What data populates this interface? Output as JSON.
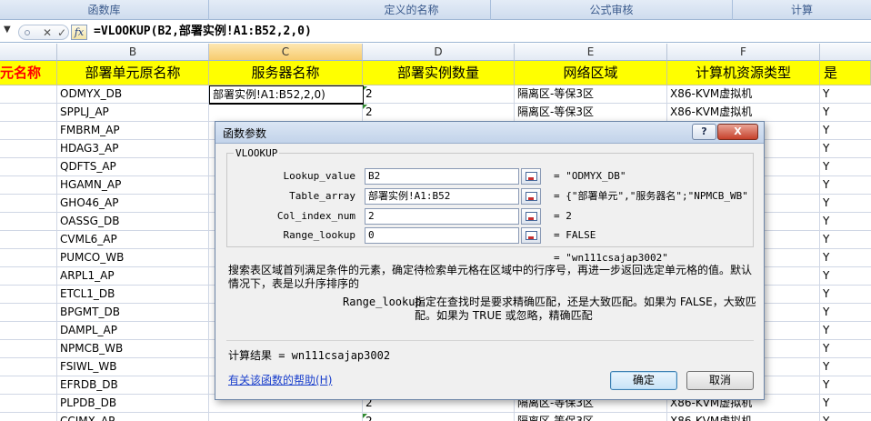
{
  "ribbon": {
    "groups": [
      "函数库",
      "定义的名称",
      "公式审核",
      "计算"
    ]
  },
  "formula_bar": {
    "formula": "=VLOOKUP(B2,部署实例!A1:B52,2,0)",
    "fx_label": "fx"
  },
  "columns": [
    "B",
    "C",
    "D",
    "E",
    "F"
  ],
  "header_row": [
    "元名称",
    "部署单元原名称",
    "服务器名称",
    "部署实例数量",
    "网络区域",
    "计算机资源类型",
    "是"
  ],
  "editing_cell_text": "部署实例!A1:B52,2,0)",
  "rows": [
    {
      "b": "ODMYX_DB",
      "d": "2",
      "e": "隔离区-等保3区",
      "f": "X86-KVM虚拟机",
      "g": "Y"
    },
    {
      "b": "SPPLJ_AP",
      "d": "2",
      "e": "隔离区-等保3区",
      "f": "X86-KVM虚拟机",
      "g": "Y"
    },
    {
      "b": "FMBRM_AP",
      "d": "",
      "e": "",
      "f": "",
      "g": "Y"
    },
    {
      "b": "HDAG3_AP",
      "d": "",
      "e": "",
      "f": "",
      "g": "Y"
    },
    {
      "b": "QDFTS_AP",
      "d": "",
      "e": "",
      "f": "",
      "g": "Y"
    },
    {
      "b": "HGAMN_AP",
      "d": "",
      "e": "",
      "f": "",
      "g": "Y"
    },
    {
      "b": "GHO46_AP",
      "d": "",
      "e": "",
      "f": "",
      "g": "Y"
    },
    {
      "b": "OASSG_DB",
      "d": "",
      "e": "",
      "f": "",
      "g": "Y"
    },
    {
      "b": "CVML6_AP",
      "d": "",
      "e": "",
      "f": "",
      "g": "Y"
    },
    {
      "b": "PUMCO_WB",
      "d": "",
      "e": "",
      "f": "",
      "g": "Y"
    },
    {
      "b": "ARPL1_AP",
      "d": "",
      "e": "",
      "f": "",
      "g": "Y"
    },
    {
      "b": "ETCL1_DB",
      "d": "",
      "e": "",
      "f": "",
      "g": "Y"
    },
    {
      "b": "BPGMT_DB",
      "d": "",
      "e": "",
      "f": "",
      "g": "Y"
    },
    {
      "b": "DAMPL_AP",
      "d": "",
      "e": "",
      "f": "",
      "g": "Y"
    },
    {
      "b": "NPMCB_WB",
      "d": "",
      "e": "",
      "f": "",
      "g": "Y"
    },
    {
      "b": "FSIWL_WB",
      "d": "",
      "e": "",
      "f": "",
      "g": "Y"
    },
    {
      "b": "EFRDB_DB",
      "d": "",
      "e": "",
      "f": "",
      "g": "Y"
    },
    {
      "b": "PLPDB_DB",
      "d": "2",
      "e": "隔离区-等保3区",
      "f": "X86-KVM虚拟机",
      "g": "Y"
    },
    {
      "b": "CCIMX_AP",
      "d": "2",
      "e": "隔离区-等保3区",
      "f": "X86-KVM虚拟机",
      "g": "Y"
    }
  ],
  "dialog": {
    "title": "函数参数",
    "help_btn": "?",
    "close_btn": "X",
    "function_name": "VLOOKUP",
    "args": [
      {
        "label": "Lookup_value",
        "value": "B2",
        "result": "= \"ODMYX_DB\""
      },
      {
        "label": "Table_array",
        "value": "部署实例!A1:B52",
        "result": "= {\"部署单元\",\"服务器名\";\"NPMCB_WB\""
      },
      {
        "label": "Col_index_num",
        "value": "2",
        "result": "= 2"
      },
      {
        "label": "Range_lookup",
        "value": "0",
        "result": "= FALSE"
      }
    ],
    "overall_result": "= \"wn111csajap3002\"",
    "description": "搜索表区域首列满足条件的元素，确定待检索单元格在区域中的行序号，再进一步返回选定单元格的值。默认情况下，表是以升序排序的",
    "param_name": "Range_lookup",
    "param_desc_1": "指定在查找时是要求精确匹配，还是大致匹配。如果为 FALSE，大致匹",
    "param_desc_2": "配。如果为 TRUE 或忽略，精确匹配",
    "calc_result": "计算结果 = wn111csajap3002",
    "help_link": "有关该函数的帮助(H)",
    "ok": "确定",
    "cancel": "取消"
  }
}
